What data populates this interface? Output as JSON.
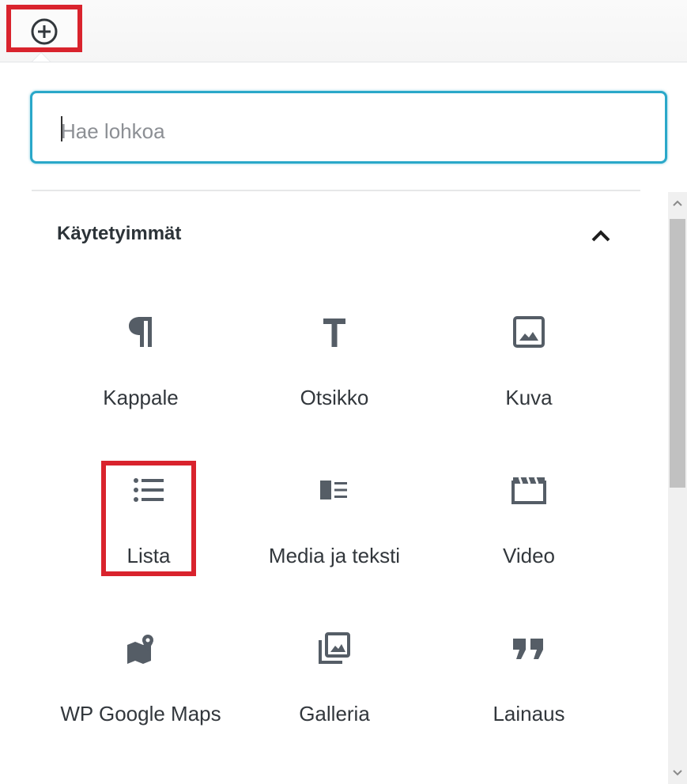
{
  "search": {
    "placeholder": "Hae lohkoa",
    "value": ""
  },
  "section": {
    "title": "Käytetyimmät"
  },
  "blocks": [
    {
      "label": "Kappale",
      "icon": "paragraph-icon"
    },
    {
      "label": "Otsikko",
      "icon": "heading-icon"
    },
    {
      "label": "Kuva",
      "icon": "image-icon"
    },
    {
      "label": "Lista",
      "icon": "list-icon"
    },
    {
      "label": "Media ja teksti",
      "icon": "media-text-icon"
    },
    {
      "label": "Video",
      "icon": "video-icon"
    },
    {
      "label": "WP Google Maps",
      "icon": "map-icon"
    },
    {
      "label": "Galleria",
      "icon": "gallery-icon"
    },
    {
      "label": "Lainaus",
      "icon": "quote-icon"
    }
  ],
  "colors": {
    "accent": "#2aa8c9",
    "highlight": "#d9232d",
    "icon": "#555d66"
  }
}
